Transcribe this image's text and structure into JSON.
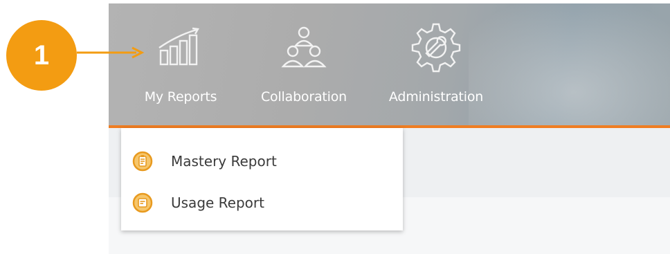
{
  "callout": {
    "step_number": "1",
    "color": "#f39c12"
  },
  "nav": {
    "items": [
      {
        "label": "My Reports",
        "icon": "reports-chart-icon"
      },
      {
        "label": "Collaboration",
        "icon": "collaboration-people-icon"
      },
      {
        "label": "Administration",
        "icon": "administration-gear-wrench-icon"
      }
    ],
    "accent_color": "#ef7d22"
  },
  "dropdown": {
    "items": [
      {
        "label": "Mastery Report",
        "icon": "report-document-icon"
      },
      {
        "label": "Usage Report",
        "icon": "report-document-icon"
      }
    ]
  }
}
